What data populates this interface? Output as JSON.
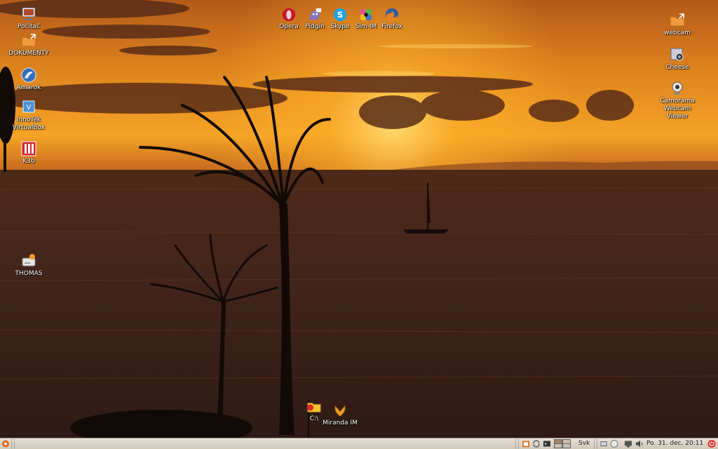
{
  "desktop_left": [
    {
      "label": "Počítač",
      "icon": "computer-icon"
    },
    {
      "label": "DOKUMENTY",
      "icon": "folder-link-icon"
    },
    {
      "label": "Amarok",
      "icon": "amarok-icon"
    },
    {
      "label": "InnoTek\nVirtualBox",
      "icon": "virtualbox-icon"
    },
    {
      "label": "K3b",
      "icon": "k3b-icon"
    },
    {
      "label": "THOMAS",
      "icon": "drive-icon"
    }
  ],
  "launchers": [
    {
      "label": "Opera",
      "icon": "opera-icon"
    },
    {
      "label": "Pidgin",
      "icon": "pidgin-icon"
    },
    {
      "label": "Skype",
      "icon": "skype-icon"
    },
    {
      "label": "Sim-IM",
      "icon": "sim-im-icon"
    },
    {
      "label": "Firefox",
      "icon": "firefox-icon"
    }
  ],
  "desktop_right": [
    {
      "label": "webcam",
      "icon": "folder-link-icon"
    },
    {
      "label": "Cheese",
      "icon": "cheese-icon"
    },
    {
      "label": "Camorama\nWebcam\nViewer",
      "icon": "webcam-icon"
    }
  ],
  "desktop_bottom": [
    {
      "label": "C:\\",
      "icon": "folder-icon"
    },
    {
      "label": "Miranda IM",
      "icon": "miranda-icon"
    }
  ],
  "taskbar": {
    "keyboard_layout": "Svk",
    "clock": "Po. 31. dec. 20:11",
    "start_icon": "start-menu-icon",
    "tray_icons": [
      "file-manager-icon",
      "refresh-icon",
      "terminal-icon",
      "desktop-pager-icon"
    ],
    "status_icons": [
      "network-icon",
      "chat-status-icon",
      "display-icon",
      "volume-icon"
    ],
    "logout_icon": "power-icon"
  },
  "colors": {
    "sky_top": "#c8691c",
    "sun_glow": "#ffb02a",
    "sea": "#3a2218",
    "taskbar": "#ddd6cb",
    "power_red": "#d8281e"
  }
}
